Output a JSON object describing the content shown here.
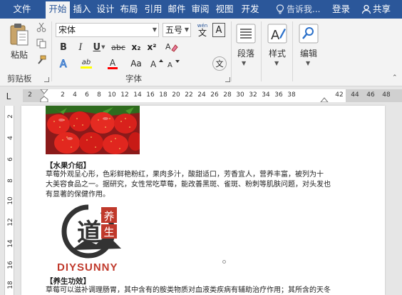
{
  "tabs": [
    {
      "label": "文件",
      "active": false
    },
    {
      "label": "开始",
      "active": true
    },
    {
      "label": "插入",
      "active": false
    },
    {
      "label": "设计",
      "active": false
    },
    {
      "label": "布局",
      "active": false
    },
    {
      "label": "引用",
      "active": false
    },
    {
      "label": "邮件",
      "active": false
    },
    {
      "label": "审阅",
      "active": false
    },
    {
      "label": "视图",
      "active": false
    },
    {
      "label": "开发",
      "active": false
    }
  ],
  "tell_me": "告诉我...",
  "login": "登录",
  "share": "共享",
  "ribbon": {
    "clipboard": {
      "paste_label": "粘贴",
      "group_label": "剪贴板"
    },
    "font": {
      "font_name": "宋体",
      "font_size": "五号",
      "wen_label": "wén",
      "wen_char": "文",
      "a_label": "A",
      "bold": "B",
      "italic": "I",
      "underline": "U",
      "strike": "abc",
      "subscript": "x₂",
      "superscript": "x²",
      "aa_label": "Aa",
      "group_label": "字体",
      "highlight_color": "#ffff00",
      "font_color": "#ff0000"
    },
    "paragraph": {
      "label": "段落"
    },
    "styles": {
      "label": "样式"
    },
    "editing": {
      "label": "编辑"
    }
  },
  "ruler": {
    "selector": "L",
    "numbers": [
      "2",
      "2",
      "4",
      "6",
      "8",
      "10",
      "12",
      "14",
      "16",
      "18",
      "20",
      "22",
      "24",
      "26",
      "28",
      "30",
      "32",
      "34",
      "36",
      "38",
      "42",
      "44",
      "46",
      "48"
    ],
    "vnumbers": [
      "2",
      "4",
      "6",
      "8",
      "10",
      "12",
      "14",
      "16",
      "18"
    ]
  },
  "document": {
    "heading1": "【水果介绍】",
    "para1_line1": "草莓外观呈心形，色彩鲜艳粉红，果肉多汁，酸甜适口，芳香宜人，营养丰富，被列为十",
    "para1_line2": "大美容食品之一。据研究，女性常吃草莓，能改善黑斑、雀斑、粉刺等肌肤问题，对头发也",
    "para1_line3": "有显著的保健作用。",
    "logo_char": "道",
    "logo_stamp": "养生",
    "logo_text": "DIYSUNNY",
    "heading2": "【养生功效】",
    "para2_line1": "草莓可以滋补调理肠胃，其中含有的胺类物质对血液类疾病有辅助治疗作用；其所含的天冬"
  },
  "colors": {
    "accent": "#2b579a",
    "logo_red": "#c0392b",
    "logo_dark": "#333333"
  }
}
